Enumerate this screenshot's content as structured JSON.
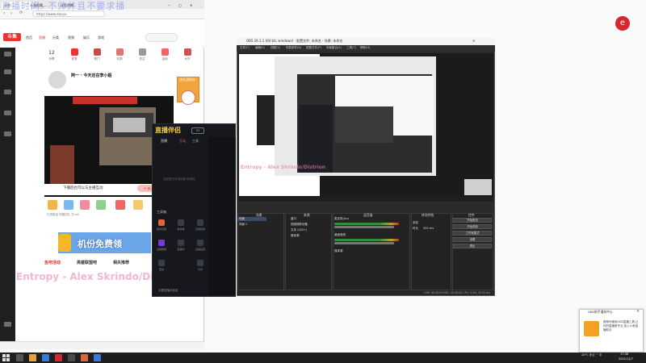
{
  "overlay_banner": "直播时间: 不帅并且不要求播",
  "colors": {
    "accent": "#e8352e",
    "obs_bg": "#2b2b2b",
    "stream_app_bg": "#16181d",
    "pink": "#e87ab0"
  },
  "browser": {
    "tabs": [
      "斗鱼-...",
      "斗鱼直播_...",
      "斗鱼直播"
    ],
    "url": "https://www.douyu",
    "site_logo": "斗鱼",
    "nav": [
      "首页",
      "直播",
      "分类",
      "视频",
      "娱乐",
      "游戏"
    ],
    "quick_icons": [
      "分享",
      "任务",
      "热门",
      "礼物",
      "关注",
      "活动",
      "大厅"
    ],
    "quick_count": "12",
    "stream_title": "阿一 · 今天还在李小姐",
    "promo": "送礼送粉丝",
    "player_caption": "下播后也可以与主播互动",
    "follow_label": "+ 关注主播",
    "gift_caption": "礼物数量  快捷送礼  打call",
    "ad_text": "机份免费领",
    "taglines": [
      "鱼吧活动",
      "英雄联盟吧",
      "相关推荐"
    ],
    "song_overlay": "Entropy - Alex Skrindo/Distrion"
  },
  "stream_app": {
    "logo": "直播伴侣",
    "badge": "V3",
    "tabs": [
      "直播",
      "互动",
      "工具"
    ],
    "hint": "当前暂无可用场景,请添加",
    "section": "工具箱",
    "tools": [
      "我的直播",
      "粉丝榜",
      "直播回放",
      "直播数据",
      "直播间",
      "直播设置",
      "更多",
      "分享"
    ],
    "bottom": "设置直播间信息"
  },
  "obs": {
    "title": "OBS 26.1.1 (64 bit, windows) - 配置文件: 未命名 - 场景: 未命名",
    "menu": [
      "文件(F)",
      "编辑(E)",
      "视图(V)",
      "停靠部件(D)",
      "配置文件(P)",
      "场景集合(S)",
      "工具(T)",
      "帮助(H)"
    ],
    "docks": [
      "场景",
      "来源",
      "混音器",
      "转场特效",
      "控件"
    ],
    "scenes": [
      "场景",
      "场景 2"
    ],
    "sources": [
      "窗口",
      "视频捕获设备",
      "文本 (GDI+)",
      "媒体源"
    ],
    "mixer": [
      "麦克风/Aux",
      "桌面音频",
      "媒体源"
    ],
    "transition": [
      "渐变",
      "时长",
      "300 ms"
    ],
    "controls": [
      "开始推流",
      "开始录制",
      "工作室模式",
      "设置",
      "退出"
    ],
    "status": "LIVE: 00:00:00  REC: 00:00:00  CPU: 3.0%, 30.00 fps"
  },
  "toast": {
    "title": "OBS助手通知中心",
    "body": "推荐你使用OBS直播工具,让你的直播更专业,加入斗鱼直播助手"
  },
  "taskbar": {
    "tray": "28°C  多云 ^  中",
    "time": "17:38",
    "date": "2021/12/7"
  }
}
